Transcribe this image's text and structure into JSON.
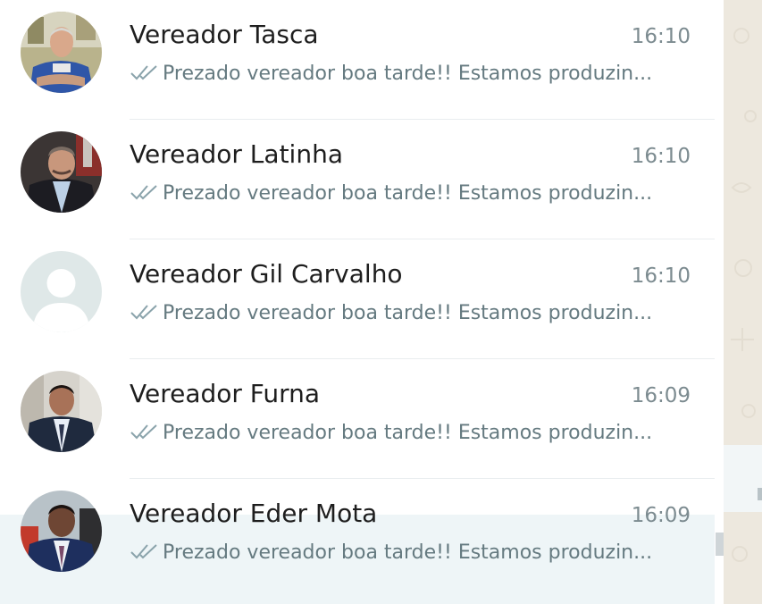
{
  "chats": [
    {
      "name": "Vereador Tasca",
      "time": "16:10",
      "preview": "Prezado vereador boa tarde!! Estamos produzin...",
      "status_icon": "double-check-icon"
    },
    {
      "name": "Vereador Latinha",
      "time": "16:10",
      "preview": "Prezado vereador boa tarde!! Estamos produzin...",
      "status_icon": "double-check-icon"
    },
    {
      "name": "Vereador Gil Carvalho",
      "time": "16:10",
      "preview": "Prezado vereador boa tarde!! Estamos produzin...",
      "status_icon": "double-check-icon",
      "avatar": "default-avatar-icon"
    },
    {
      "name": "Vereador Furna",
      "time": "16:09",
      "preview": "Prezado vereador boa tarde!! Estamos produzin...",
      "status_icon": "double-check-icon"
    },
    {
      "name": "Vereador Eder Mota",
      "time": "16:09",
      "preview": "Prezado vereador boa tarde!! Estamos produzin...",
      "status_icon": "double-check-icon"
    }
  ],
  "colors": {
    "name_text": "#1e1e1e",
    "time_text": "#7c8b90",
    "preview_text": "#657a80",
    "tick_color": "#8aa3ab",
    "divider": "#e9edef",
    "side_panel": "#ede8de",
    "default_avatar_bg": "#dfe5e7"
  }
}
